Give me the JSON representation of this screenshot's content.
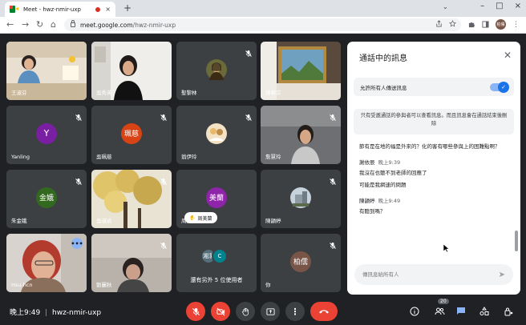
{
  "browser": {
    "tab_title": "Meet - hwz-nmir-uxp",
    "url_host": "meet.google.com",
    "url_path": "/hwz-nmir-uxp",
    "new_tab": "+",
    "tab_close": "×",
    "back": "←",
    "forward": "→",
    "reload": "↻",
    "home": "⌂",
    "profile_initials": "柏儒",
    "chevron": "⌄",
    "minimize": "–",
    "maximize": "□",
    "close": "×"
  },
  "tiles": [
    {
      "name": "王淑芬",
      "kind": "photo",
      "scene": "woman-desk"
    },
    {
      "name": "吳秀英",
      "kind": "photo",
      "scene": "woman-room"
    },
    {
      "name": "聖黎林",
      "kind": "avatar-photo",
      "scene": "mona-lisa",
      "muted": true
    },
    {
      "name": "陳華宗",
      "kind": "photo",
      "scene": "mural"
    },
    {
      "name": "Yanling",
      "kind": "avatar",
      "initial": "Y",
      "color": "#7b1fa2",
      "muted": true
    },
    {
      "name": "吳珮慈",
      "kind": "avatar",
      "initial": "珮慈",
      "color": "#d84315",
      "muted": true
    },
    {
      "name": "翁伊玲",
      "kind": "avatar-photo",
      "scene": "cartoon",
      "muted": true
    },
    {
      "name": "詹慧玲",
      "kind": "photo",
      "scene": "woman-dark",
      "muted": true
    },
    {
      "name": "朱金娥",
      "kind": "avatar",
      "initial": "金娥",
      "color": "#33691e",
      "muted": true
    },
    {
      "name": "吳淑貞",
      "kind": "photo",
      "scene": "tree",
      "muted": true
    },
    {
      "name": "周美蘭",
      "kind": "avatar",
      "initial": "美蘭",
      "color": "#8e24aa",
      "raise": "周美蘭"
    },
    {
      "name": "陳韻婷",
      "kind": "avatar-photo",
      "scene": "building",
      "muted": true
    },
    {
      "name": "Hsu-hcn",
      "kind": "photo",
      "scene": "woman-red",
      "active": true
    },
    {
      "name": "劉麗秋",
      "kind": "photo",
      "scene": "woman-blur",
      "muted": true
    },
    {
      "name": "還有另外 5 位使用者",
      "kind": "group",
      "initials": [
        "湘潔",
        "C"
      ]
    },
    {
      "name": "你",
      "kind": "avatar",
      "initial": "柏儒",
      "color": "#795548",
      "muted": true
    }
  ],
  "chat": {
    "title": "通話中的訊息",
    "allow_label": "允許所有人傳送訊息",
    "notice": "只有受邀通話的參與者可以查看訊息。而且訊息會在通話結束後刪除",
    "messages": [
      {
        "type": "text",
        "text": "節有是在地的福是外來的？化的客有哪些參與上的困難點啊？"
      },
      {
        "type": "head",
        "sender": "謝依辰",
        "time": "晚上9:39"
      },
      {
        "type": "text",
        "text": "我沒在也聽不到老師的回應了"
      },
      {
        "type": "text",
        "text": "可能是我網速的問題"
      },
      {
        "type": "head",
        "sender": "陳韻婷",
        "time": "晚上9:49"
      },
      {
        "type": "text",
        "text": "有聽到嗎？"
      }
    ],
    "input_placeholder": "傳訊息給所有人",
    "send_icon": "➤",
    "close_icon": "✕"
  },
  "bottom": {
    "time": "晚上9:49",
    "separator": "|",
    "meeting_code": "hwz-nmir-uxp",
    "people_count": "20"
  }
}
